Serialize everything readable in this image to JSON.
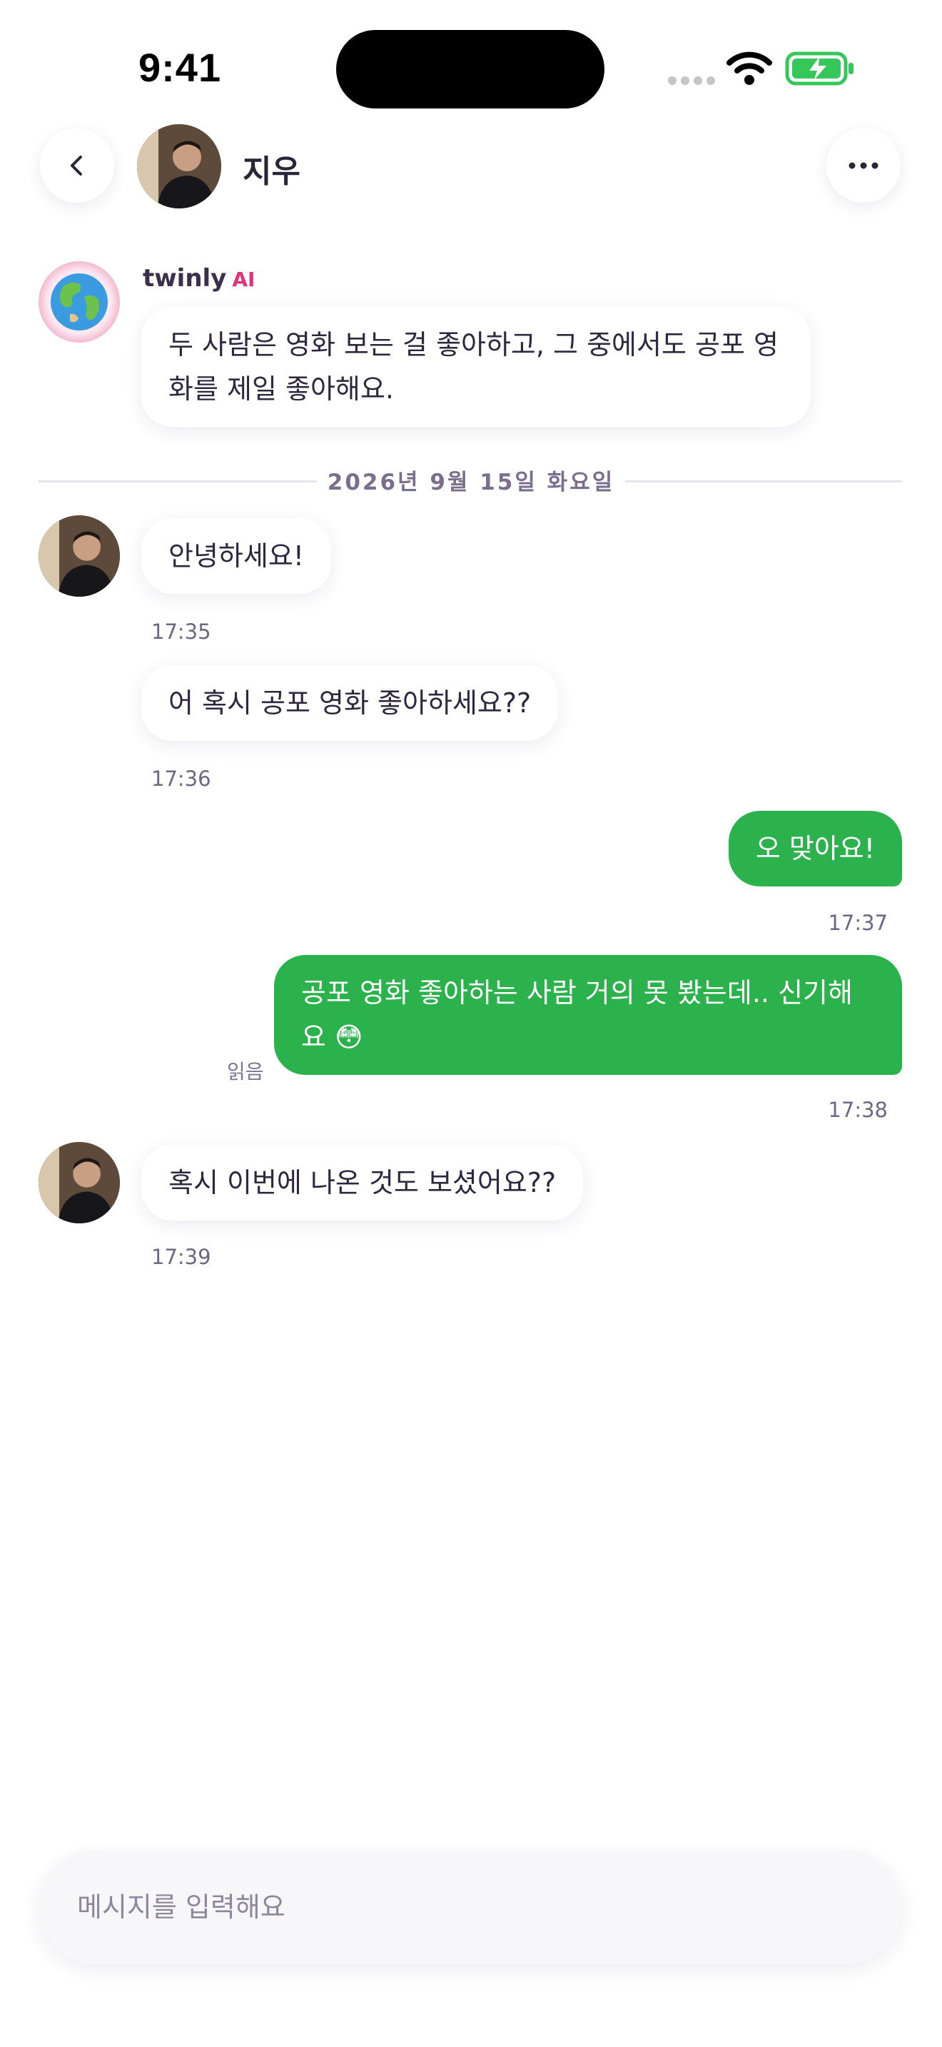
{
  "status_bar": {
    "time": "9:41"
  },
  "header": {
    "name": "지우"
  },
  "ai_summary": {
    "sender": "twinly",
    "tag": "AI",
    "text": "두 사람은 영화 보는 걸 좋아하고, 그 중에서도 공포 영화를 제일 좋아해요."
  },
  "date_divider": "2026년 9월 15일 화요일",
  "messages": [
    {
      "direction": "incoming",
      "text": "안녕하세요!",
      "time": "17:35"
    },
    {
      "direction": "incoming",
      "text": "어 혹시 공포 영화 좋아하세요??",
      "time": "17:36"
    },
    {
      "direction": "outgoing",
      "text": "오 맞아요!",
      "time": "17:37"
    },
    {
      "direction": "outgoing",
      "text": "공포 영화 좋아하는 사람 거의 못 봤는데.. 신기해요 😳",
      "time": "17:38",
      "read_label": "읽음"
    },
    {
      "direction": "incoming",
      "text": "혹시 이번에 나온 것도 보셨어요??",
      "time": "17:39"
    }
  ],
  "input": {
    "placeholder": "메시지를 입력해요"
  },
  "colors": {
    "outgoing_bubble": "#2bb24c",
    "ai_tag": "#e0347a",
    "battery": "#35c759"
  },
  "icons": [
    "back-chevron-icon",
    "more-dots-icon",
    "wifi-icon",
    "battery-charging-icon",
    "globe-icon"
  ]
}
